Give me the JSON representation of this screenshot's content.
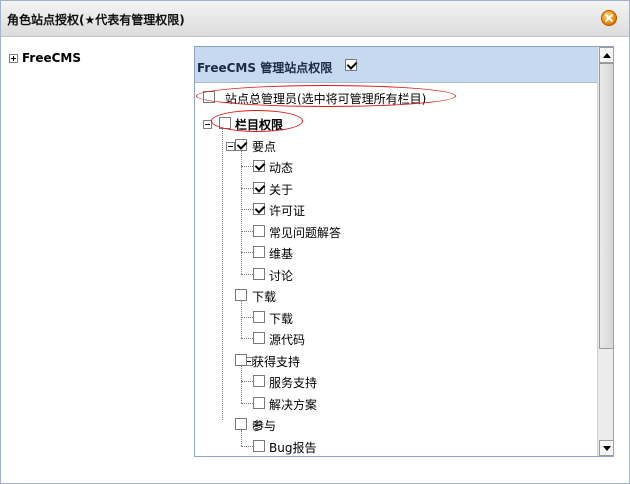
{
  "dialog": {
    "title": "角色站点授权(★代表有管理权限)"
  },
  "site_tree": {
    "root_label": "FreeCMS"
  },
  "panel": {
    "header_label": "FreeCMS 管理站点权限",
    "header_checked": true,
    "site_admin_label": "站点总管理员(选中将可管理所有栏目)",
    "column_perm_label": "栏目权限",
    "groups": [
      {
        "label": "要点",
        "checked": true,
        "items": [
          {
            "label": "动态",
            "checked": true
          },
          {
            "label": "关于",
            "checked": true
          },
          {
            "label": "许可证",
            "checked": true
          },
          {
            "label": "常见问题解答",
            "checked": false
          },
          {
            "label": "维基",
            "checked": false
          },
          {
            "label": "讨论",
            "checked": false
          }
        ]
      },
      {
        "label": "下载",
        "checked": false,
        "items": [
          {
            "label": "下载",
            "checked": false
          },
          {
            "label": "源代码",
            "checked": false
          }
        ]
      },
      {
        "label": "获得支持",
        "checked": false,
        "items": [
          {
            "label": "服务支持",
            "checked": false
          },
          {
            "label": "解决方案",
            "checked": false
          }
        ]
      },
      {
        "label": "参与",
        "checked": false,
        "items": [
          {
            "label": "Bug报告",
            "checked": false
          }
        ]
      }
    ]
  }
}
